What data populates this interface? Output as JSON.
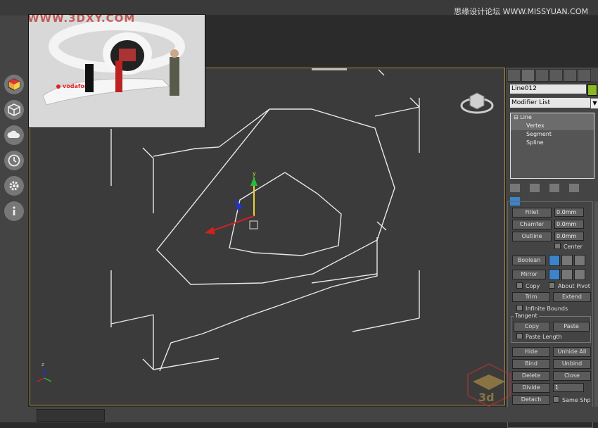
{
  "watermarks": {
    "top_left": "WWW.3DXY.COM",
    "top_right": "思缘设计论坛 WWW.MISSYUAN.COM",
    "bottom_right_glyph": "3d"
  },
  "reference_image": {
    "brand": "vodafone"
  },
  "left_toolbar": {
    "icons": [
      "cube-color-icon",
      "cube-icon",
      "cloud-icon",
      "clock-icon",
      "gear-icon",
      "info-icon"
    ]
  },
  "viewport": {
    "border_color": "#a88c3a",
    "axis_y": "y",
    "axis_x": "x",
    "axis_z": "z"
  },
  "command_panel": {
    "tabs": [
      "create",
      "modify",
      "hierarchy",
      "motion",
      "display",
      "utilities"
    ],
    "object_name": "Line012",
    "object_color": "#8ab81e",
    "modifier_list": "Modifier List",
    "stack": [
      {
        "label": "Line",
        "level": 0,
        "selected": true
      },
      {
        "label": "Vertex",
        "level": 1,
        "selected": true
      },
      {
        "label": "Segment",
        "level": 1,
        "selected": false
      },
      {
        "label": "Spline",
        "level": 1,
        "selected": false
      }
    ],
    "fillet": {
      "label": "Fillet",
      "value": "0.0mm"
    },
    "chamfer": {
      "label": "Chamfer",
      "value": "0.0mm"
    },
    "outline": {
      "label": "Outline",
      "value": "0.0mm"
    },
    "center_label": "Center",
    "boolean_label": "Boolean",
    "mirror_label": "Mirror",
    "copy_label": "Copy",
    "about_pivot_label": "About Pivot",
    "trim_label": "Trim",
    "extend_label": "Extend",
    "infinite_bounds_label": "Infinite Bounds",
    "tangent_title": "Tangent",
    "tangent_copy": "Copy",
    "tangent_paste": "Paste",
    "paste_length_label": "Paste Length",
    "hide_label": "Hide",
    "unhide_all_label": "Unhide All",
    "bind_label": "Bind",
    "unbind_label": "Unbind",
    "delete_label": "Delete",
    "close_label": "Close",
    "divide_label": "Divide",
    "divide_value": "1",
    "detach_label": "Detach",
    "same_shp_label": "Same Shp"
  }
}
